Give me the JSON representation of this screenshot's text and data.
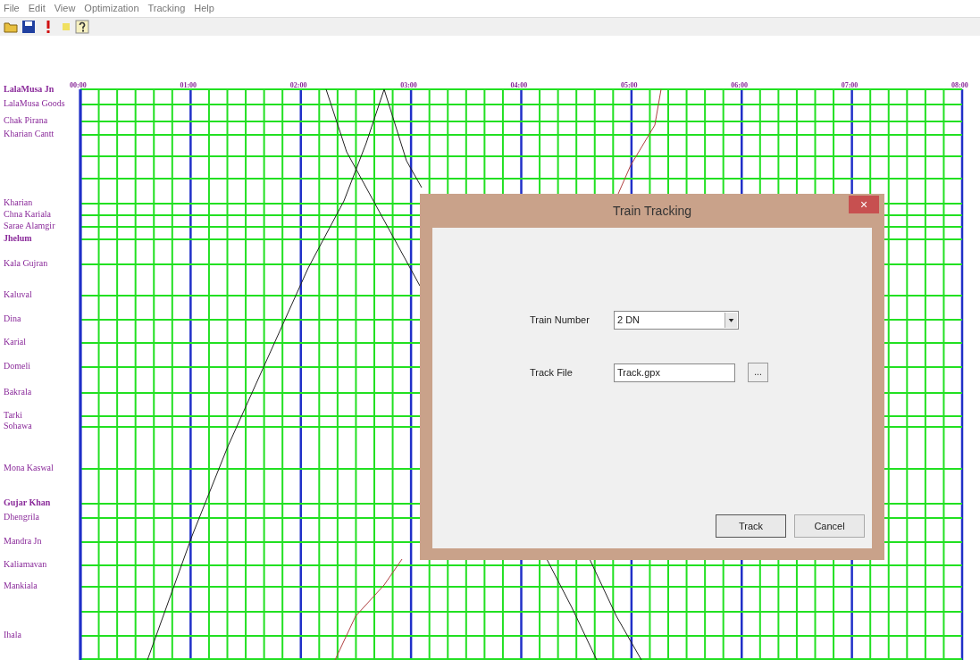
{
  "menu": [
    "File",
    "Edit",
    "View",
    "Optimization",
    "Tracking",
    "Help"
  ],
  "graph": {
    "times": [
      "00:00",
      "01:00",
      "02:00",
      "03:00",
      "04:00",
      "05:00",
      "06:00",
      "07:00",
      "08:00"
    ],
    "stations": [
      {
        "name": "LalaMusa Jn",
        "major": true
      },
      {
        "name": "LalaMusa Goods",
        "major": false
      },
      {
        "name": "Chak Pirana",
        "major": false
      },
      {
        "name": "Kharian Cantt",
        "major": false
      },
      {
        "name": "Kharian",
        "major": false
      },
      {
        "name": "Chna Kariala",
        "major": false
      },
      {
        "name": "Sarae Alamgir",
        "major": false
      },
      {
        "name": "Jhelum",
        "major": true
      },
      {
        "name": "Kala Gujran",
        "major": false
      },
      {
        "name": "Kaluval",
        "major": false
      },
      {
        "name": "Dina",
        "major": false
      },
      {
        "name": "Karial",
        "major": false
      },
      {
        "name": "Domeli",
        "major": false
      },
      {
        "name": "Bakrala",
        "major": false
      },
      {
        "name": "Tarki",
        "major": false
      },
      {
        "name": "Sohawa",
        "major": false
      },
      {
        "name": "Mona Kaswal",
        "major": false
      },
      {
        "name": "Gujar Khan",
        "major": true
      },
      {
        "name": "Dhengrila",
        "major": false
      },
      {
        "name": "Mandra Jn",
        "major": false
      },
      {
        "name": "Kaliamavan",
        "major": false
      },
      {
        "name": "Mankiala",
        "major": false
      },
      {
        "name": "Ihala",
        "major": false
      }
    ]
  },
  "dialog": {
    "title": "Train Tracking",
    "close": "×",
    "fields": [
      {
        "kind": "combo",
        "label": "Train Number",
        "value": "2 DN"
      },
      {
        "kind": "file",
        "label": "Track File",
        "value": "Track.gpx",
        "browse": "..."
      }
    ],
    "buttons": [
      "Track",
      "Cancel"
    ]
  }
}
